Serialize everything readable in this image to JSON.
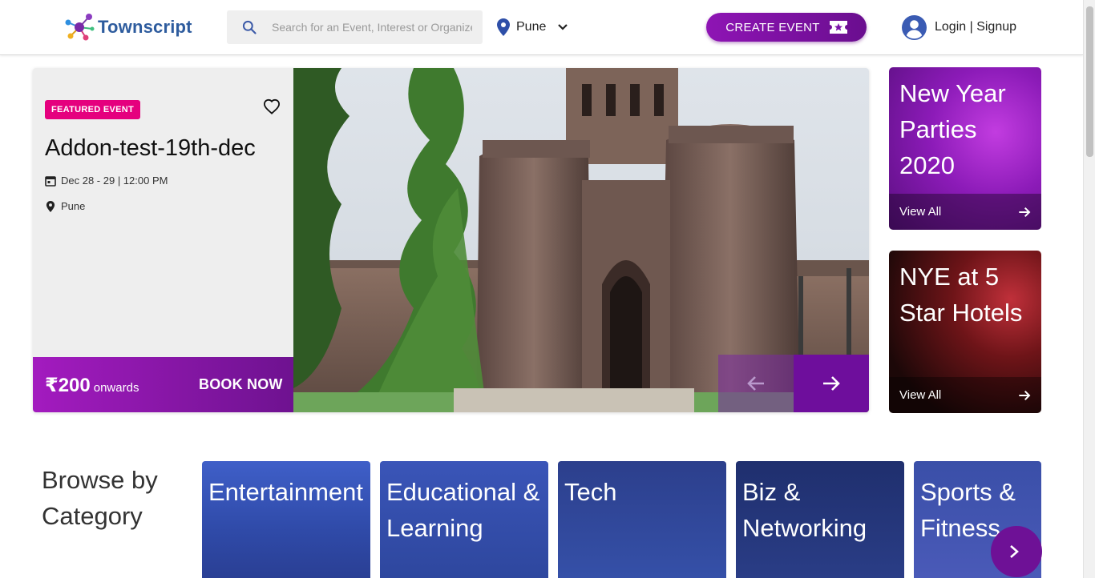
{
  "header": {
    "logo_text": "Townscript",
    "search_placeholder": "Search for an Event, Interest or Organizer",
    "city": "Pune",
    "create_event_label": "CREATE EVENT",
    "login_label": "Login | Signup"
  },
  "featured": {
    "badge": "FEATURED EVENT",
    "title": "Addon-test-19th-dec",
    "date": "Dec 28 - 29 | 12:00 PM",
    "location": "Pune",
    "price": "₹200",
    "price_suffix": "onwards",
    "book_label": "BOOK NOW"
  },
  "promos": [
    {
      "title": "New Year Parties 2020",
      "link_label": "View All"
    },
    {
      "title": "NYE at 5 Star Hotels",
      "link_label": "View All"
    }
  ],
  "browse": {
    "title": "Browse by Category",
    "categories": [
      {
        "label": "Entertainment"
      },
      {
        "label": "Educational & Learning"
      },
      {
        "label": "Tech"
      },
      {
        "label": "Biz & Networking"
      },
      {
        "label": "Sports & Fitness"
      }
    ]
  },
  "colors": {
    "brand_purple": "#7b12a8",
    "badge_pink": "#e5007e",
    "category_blue": "#3a55b8"
  },
  "icons": [
    "search-icon",
    "location-pin-icon",
    "chevron-down-icon",
    "ticket-star-icon",
    "user-avatar-icon",
    "heart-icon",
    "calendar-icon",
    "arrow-left-icon",
    "arrow-right-icon"
  ]
}
